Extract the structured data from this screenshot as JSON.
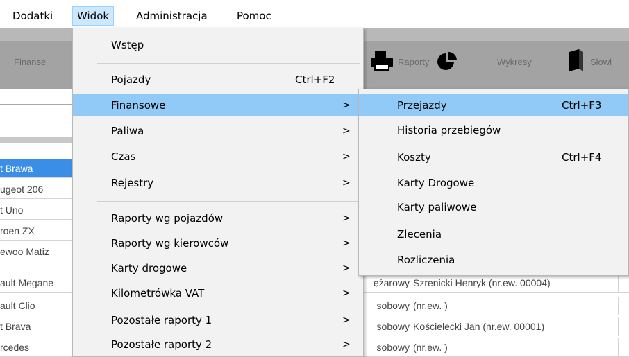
{
  "menubar": [
    {
      "label": "Dodatki"
    },
    {
      "label": "Widok"
    },
    {
      "label": "Administracja"
    },
    {
      "label": "Pomoc"
    }
  ],
  "toolbar": {
    "finanse": "Finanse",
    "raporty": "Raporty",
    "wykresy": "Wykresy",
    "slowniki": "Słowi"
  },
  "widok_menu": [
    {
      "label": "Wstęp",
      "shortcut": "",
      "submenu": false
    },
    {
      "label": "Pojazdy",
      "shortcut": "Ctrl+F2",
      "submenu": false
    },
    {
      "label": "Finansowe",
      "shortcut": "",
      "submenu": true
    },
    {
      "label": "Paliwa",
      "shortcut": "",
      "submenu": true
    },
    {
      "label": "Czas",
      "shortcut": "",
      "submenu": true
    },
    {
      "label": "Rejestry",
      "shortcut": "",
      "submenu": true
    },
    {
      "label": "Raporty wg pojazdów",
      "shortcut": "",
      "submenu": true
    },
    {
      "label": "Raporty wg kierowców",
      "shortcut": "",
      "submenu": true
    },
    {
      "label": "Karty drogowe",
      "shortcut": "",
      "submenu": true
    },
    {
      "label": "Kilometrówka VAT",
      "shortcut": "",
      "submenu": true
    },
    {
      "label": "Pozostałe raporty 1",
      "shortcut": "",
      "submenu": true
    },
    {
      "label": "Pozostałe raporty 2",
      "shortcut": "",
      "submenu": true
    }
  ],
  "finansowe_menu": [
    {
      "label": "Przejazdy",
      "shortcut": "Ctrl+F3"
    },
    {
      "label": "Historia przebiegów",
      "shortcut": ""
    },
    {
      "label": "Koszty",
      "shortcut": "Ctrl+F4"
    },
    {
      "label": "Karty Drogowe",
      "shortcut": ""
    },
    {
      "label": "Karty paliwowe",
      "shortcut": ""
    },
    {
      "label": "Zlecenia",
      "shortcut": ""
    },
    {
      "label": "Rozliczenia",
      "shortcut": ""
    }
  ],
  "arrow_glyph": ">",
  "grid_rows": [
    {
      "vehicle": "t Brawa",
      "type": "",
      "driver": ""
    },
    {
      "vehicle": "ugeot 206",
      "type": "",
      "driver": ""
    },
    {
      "vehicle": "t Uno",
      "type": "",
      "driver": ""
    },
    {
      "vehicle": "roen ZX",
      "type": "",
      "driver": ""
    },
    {
      "vehicle": "ewoo Matiz",
      "type": "",
      "driver": ""
    },
    {
      "vehicle": "ault Megane",
      "type": "ężarowy",
      "driver": "Szrenicki Henryk (nr.ew. 00004)"
    },
    {
      "vehicle": "ault Clio",
      "type": "sobowy",
      "driver": "  (nr.ew. )"
    },
    {
      "vehicle": "t Brava",
      "type": "sobowy",
      "driver": "Kościelecki Jan (nr.ew. 00001)"
    },
    {
      "vehicle": "rcedes",
      "type": "sobowy",
      "driver": "  (nr.ew. )"
    }
  ],
  "colors": {
    "menu_bg": "#f2f2f2",
    "highlight": "#91c9f7",
    "selection": "#3a8ee6",
    "toolbar": "#a3a3a3"
  }
}
